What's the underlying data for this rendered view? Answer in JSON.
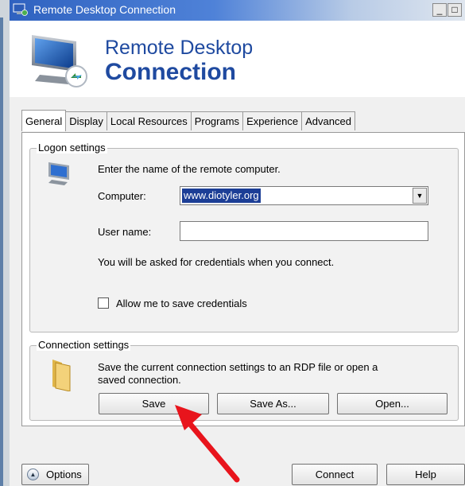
{
  "window": {
    "title": "Remote Desktop Connection",
    "minimize_glyph": "_",
    "maximize_glyph": "□"
  },
  "banner": {
    "line1": "Remote Desktop",
    "line2": "Connection",
    "logo_icon": "monitor-connection-icon"
  },
  "tabs": [
    {
      "label": "General",
      "active": true
    },
    {
      "label": "Display",
      "active": false
    },
    {
      "label": "Local Resources",
      "active": false
    },
    {
      "label": "Programs",
      "active": false
    },
    {
      "label": "Experience",
      "active": false
    },
    {
      "label": "Advanced",
      "active": false
    }
  ],
  "logon": {
    "legend": "Logon settings",
    "instruction": "Enter the name of the remote computer.",
    "computer_label": "Computer:",
    "computer_value": "www.diotyler.org",
    "username_label": "User name:",
    "username_value": "",
    "credentials_note": "You will be asked for credentials when you connect.",
    "save_credentials_label": "Allow me to save credentials",
    "save_credentials_checked": false
  },
  "connection": {
    "legend": "Connection settings",
    "description_line1": "Save the current connection settings to an RDP file or open a",
    "description_line2": "saved connection.",
    "save_label": "Save",
    "save_as_label": "Save As...",
    "open_label": "Open..."
  },
  "footer": {
    "options_label": "Options",
    "connect_label": "Connect",
    "help_label": "Help"
  },
  "colors": {
    "title_accent": "#1f4aa0",
    "annotation_arrow": "#e8141c",
    "selection": "#1c3e96"
  }
}
